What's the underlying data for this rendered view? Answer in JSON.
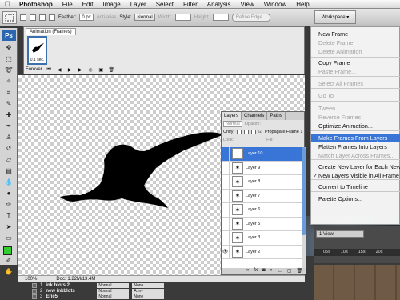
{
  "menubar": {
    "apple": "",
    "items": [
      "Photoshop",
      "File",
      "Edit",
      "Image",
      "Layer",
      "Select",
      "Filter",
      "Analysis",
      "View",
      "Window",
      "Help"
    ]
  },
  "options_bar": {
    "feather_label": "Feather:",
    "feather_value": "0 px",
    "anti_alias_label": "Anti-alias",
    "style_label": "Style:",
    "style_value": "Normal",
    "width_label": "Width:",
    "height_label": "Height:",
    "refine_edge_label": "Refine Edge...",
    "workspace_label": "Workspace"
  },
  "toolbox": {
    "logo": "Ps",
    "fg_color": "#33cc33"
  },
  "animation_panel": {
    "title": "Animation (Frames)",
    "frame_number": "1",
    "frame_delay": "0.1 sec.",
    "loop": "Forever"
  },
  "layers_panel": {
    "tabs": [
      "Layers",
      "Channels",
      "Paths"
    ],
    "blend_mode": "Normal",
    "opacity_label": "Opacity:",
    "unify_label": "Unify:",
    "propagate_label": "Propagate Frame 1",
    "lock_label": "Lock:",
    "fill_label": "Fill:",
    "layers": [
      {
        "name": "Layer 10",
        "active": true,
        "visible": false
      },
      {
        "name": "Layer 9",
        "active": false,
        "visible": false
      },
      {
        "name": "Layer 8",
        "active": false,
        "visible": false
      },
      {
        "name": "Layer 7",
        "active": false,
        "visible": false
      },
      {
        "name": "Layer 6",
        "active": false,
        "visible": false
      },
      {
        "name": "Layer 5",
        "active": false,
        "visible": false
      },
      {
        "name": "Layer 3",
        "active": false,
        "visible": false
      },
      {
        "name": "Layer 2",
        "active": false,
        "visible": true
      }
    ]
  },
  "document": {
    "zoom": "100%",
    "doc_size": "Doc: 1.22M/13.4M"
  },
  "flyout_menu": {
    "items": [
      {
        "label": "New Frame",
        "state": "normal"
      },
      {
        "label": "Delete Frame",
        "state": "disabled"
      },
      {
        "label": "Delete Animation",
        "state": "disabled"
      },
      {
        "label": "Copy Frame",
        "state": "normal"
      },
      {
        "label": "Paste Frame...",
        "state": "disabled"
      },
      {
        "label": "Select All Frames",
        "state": "disabled"
      },
      {
        "label": "Go To",
        "state": "disabled"
      },
      {
        "label": "Tween...",
        "state": "disabled"
      },
      {
        "label": "Reverse Frames",
        "state": "disabled"
      },
      {
        "label": "Optimize Animation...",
        "state": "normal"
      },
      {
        "label": "Make Frames From Layers",
        "state": "highlighted"
      },
      {
        "label": "Flatten Frames Into Layers",
        "state": "normal"
      },
      {
        "label": "Match Layer Across Frames...",
        "state": "disabled"
      },
      {
        "label": "Create New Layer for Each New",
        "state": "normal"
      },
      {
        "label": "New Layers Visible in All Frame",
        "state": "checked"
      },
      {
        "label": "Convert to Timeline",
        "state": "normal"
      },
      {
        "label": "Palette Options...",
        "state": "normal"
      }
    ]
  },
  "timeline": {
    "view_label": "1 View",
    "ruler": [
      "05s",
      "10s",
      "15s",
      "20s"
    ]
  },
  "bottom_tracks": [
    {
      "num": "1",
      "name": "ink blots 2",
      "mode": "Normal",
      "track": "None"
    },
    {
      "num": "2",
      "name": "new inkblots",
      "mode": "Normal",
      "track": "A.Inv"
    },
    {
      "num": "3",
      "name": "Eric5",
      "mode": "Normal",
      "track": "None"
    }
  ]
}
